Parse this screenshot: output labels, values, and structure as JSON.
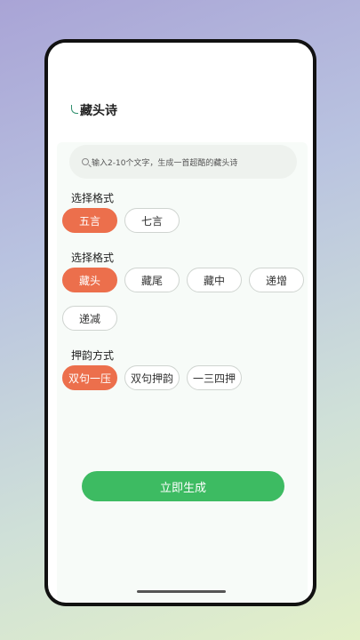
{
  "header": {
    "title": "藏头诗"
  },
  "search": {
    "placeholder": "输入2-10个文字，生成一首超酷的藏头诗"
  },
  "sections": {
    "format1": {
      "label": "选择格式",
      "options": [
        "五言",
        "七言"
      ]
    },
    "format2": {
      "label": "选择格式",
      "options": [
        "藏头",
        "藏尾",
        "藏中",
        "递增",
        "递减"
      ]
    },
    "rhyme": {
      "label": "押韵方式",
      "options": [
        "双句一压",
        "双句押韵",
        "一三四押"
      ]
    }
  },
  "actions": {
    "generate_label": "立即生成"
  },
  "colors": {
    "accent": "#ec6f4c",
    "primary": "#3dbb62"
  }
}
